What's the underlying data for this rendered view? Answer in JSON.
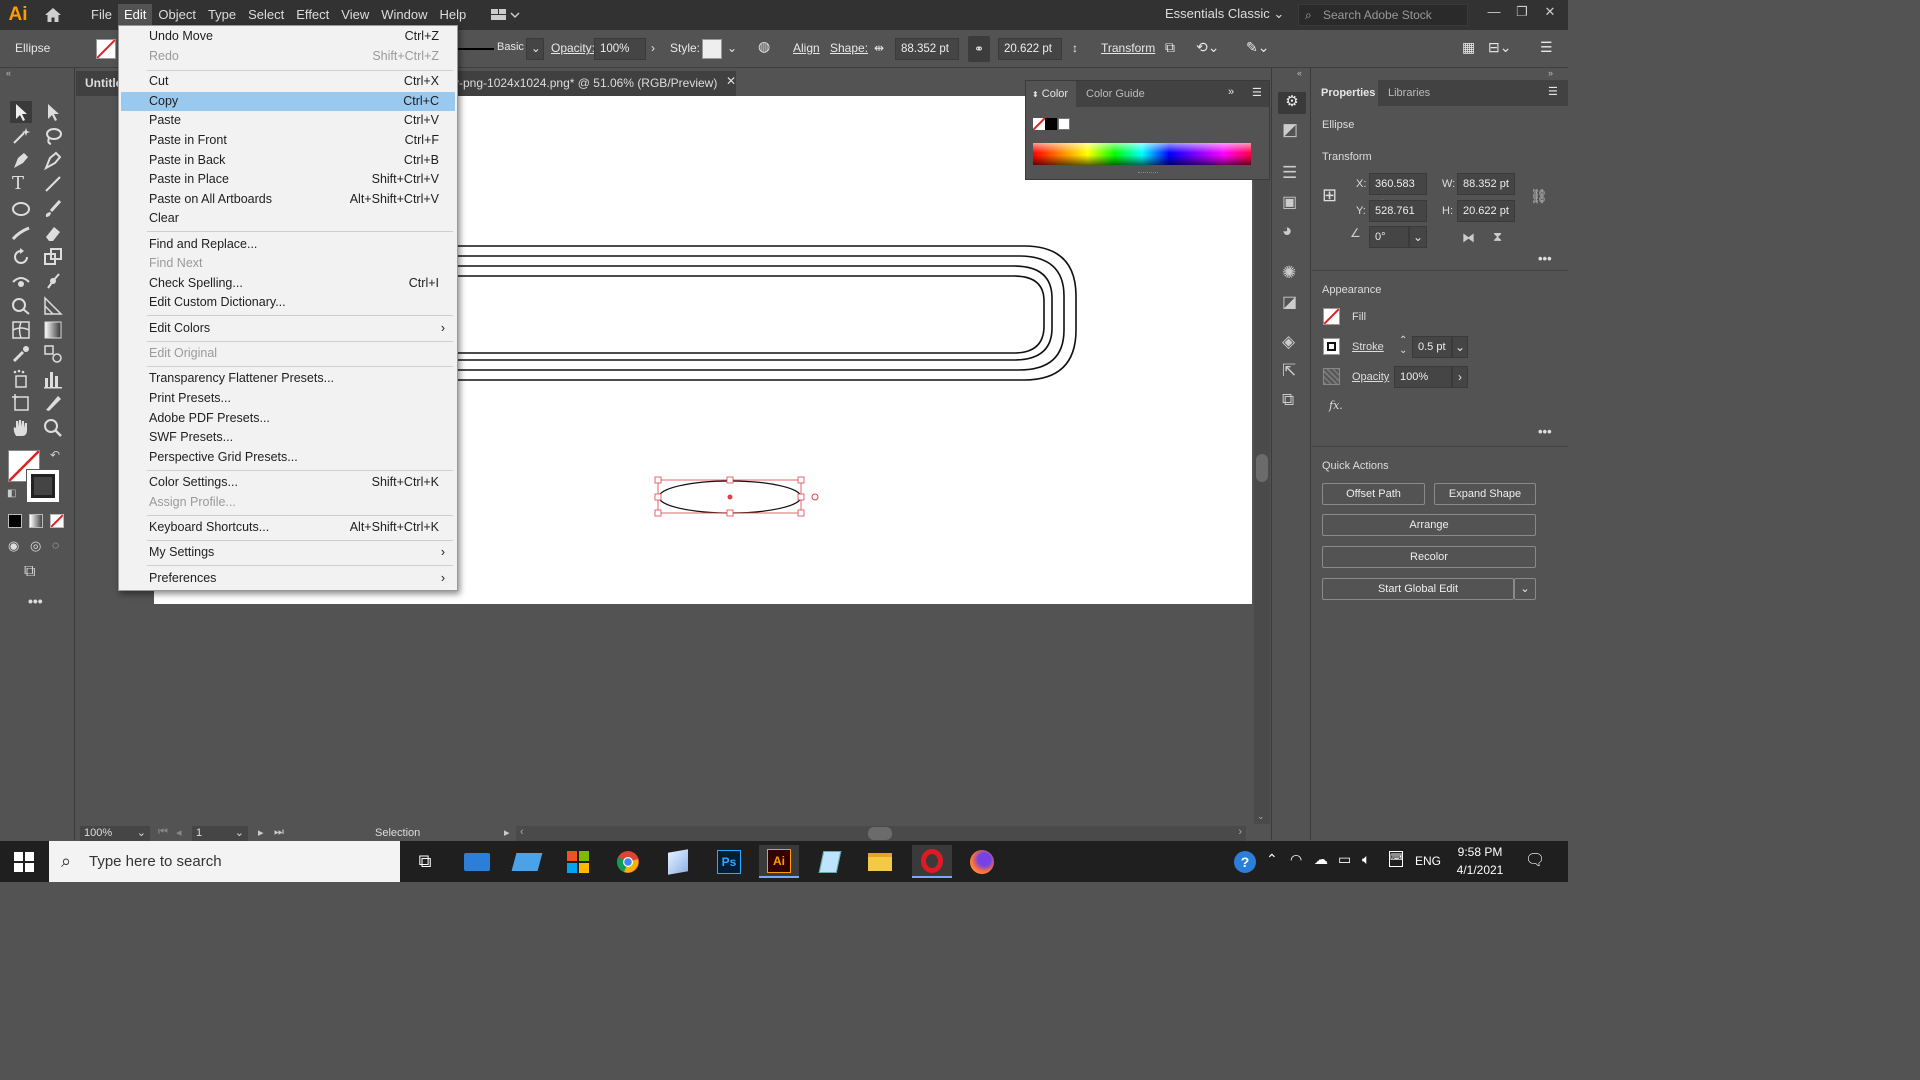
{
  "app": {
    "logo": "Ai",
    "workspace": "Essentials Classic",
    "stock_search_placeholder": "Search Adobe Stock"
  },
  "menubar": [
    "File",
    "Edit",
    "Object",
    "Type",
    "Select",
    "Effect",
    "View",
    "Window",
    "Help"
  ],
  "control_bar": {
    "selection_type": "Ellipse",
    "stroke_style": "Basic",
    "opacity_label": "Opacity:",
    "opacity_value": "100%",
    "style_label": "Style:",
    "align_label": "Align",
    "shape_label": "Shape:",
    "width_value": "88.352 pt",
    "height_value": "20.622 pt",
    "transform_label": "Transform"
  },
  "document": {
    "tab_title_left": "Untitle",
    "tab_title_right": "y-png-1024x1024.png* @ 51.06% (RGB/Preview)"
  },
  "color_panel": {
    "tab_color": "Color",
    "tab_color_guide": "Color Guide"
  },
  "properties": {
    "tab_properties": "Properties",
    "tab_libraries": "Libraries",
    "object_type": "Ellipse",
    "transform_title": "Transform",
    "x_label": "X:",
    "x_value": "360.583 pt",
    "y_label": "Y:",
    "y_value": "528.761 pt",
    "w_label": "W:",
    "w_value": "88.352 pt",
    "h_label": "H:",
    "h_value": "20.622 pt",
    "rotate_value": "0°",
    "appearance_title": "Appearance",
    "fill_label": "Fill",
    "stroke_label": "Stroke",
    "stroke_value": "0.5 pt",
    "opacity_label": "Opacity",
    "opacity_value": "100%",
    "fx_label": "fx.",
    "quick_actions_title": "Quick Actions",
    "btn_offset_path": "Offset Path",
    "btn_expand_shape": "Expand Shape",
    "btn_arrange": "Arrange",
    "btn_recolor": "Recolor",
    "btn_global_edit": "Start Global Edit"
  },
  "status_bar": {
    "zoom": "100%",
    "artboard_num": "1",
    "tool": "Selection"
  },
  "edit_menu": [
    {
      "label": "Undo Move",
      "shortcut": "Ctrl+Z"
    },
    {
      "label": "Redo",
      "shortcut": "Shift+Ctrl+Z",
      "disabled": true
    },
    {
      "label": "Cut",
      "shortcut": "Ctrl+X"
    },
    {
      "label": "Copy",
      "shortcut": "Ctrl+C",
      "highlighted": true
    },
    {
      "label": "Paste",
      "shortcut": "Ctrl+V"
    },
    {
      "label": "Paste in Front",
      "shortcut": "Ctrl+F"
    },
    {
      "label": "Paste in Back",
      "shortcut": "Ctrl+B"
    },
    {
      "label": "Paste in Place",
      "shortcut": "Shift+Ctrl+V"
    },
    {
      "label": "Paste on All Artboards",
      "shortcut": "Alt+Shift+Ctrl+V"
    },
    {
      "label": "Clear",
      "shortcut": ""
    },
    {
      "label": "Find and Replace...",
      "shortcut": ""
    },
    {
      "label": "Find Next",
      "shortcut": "",
      "disabled": true
    },
    {
      "label": "Check Spelling...",
      "shortcut": "Ctrl+I"
    },
    {
      "label": "Edit Custom Dictionary...",
      "shortcut": ""
    },
    {
      "label": "Edit Colors",
      "shortcut": "",
      "submenu": true
    },
    {
      "label": "Edit Original",
      "shortcut": "",
      "disabled": true
    },
    {
      "label": "Transparency Flattener Presets...",
      "shortcut": ""
    },
    {
      "label": "Print Presets...",
      "shortcut": ""
    },
    {
      "label": "Adobe PDF Presets...",
      "shortcut": ""
    },
    {
      "label": "SWF Presets...",
      "shortcut": ""
    },
    {
      "label": "Perspective Grid Presets...",
      "shortcut": ""
    },
    {
      "label": "Color Settings...",
      "shortcut": "Shift+Ctrl+K"
    },
    {
      "label": "Assign Profile...",
      "shortcut": "",
      "disabled": true
    },
    {
      "label": "Keyboard Shortcuts...",
      "shortcut": "Alt+Shift+Ctrl+K"
    },
    {
      "label": "My Settings",
      "shortcut": "",
      "submenu": true
    },
    {
      "label": "Preferences",
      "shortcut": "",
      "submenu": true
    }
  ],
  "taskbar": {
    "search_placeholder": "Type here to search",
    "language": "ENG",
    "time": "9:58 PM",
    "date": "4/1/2021"
  }
}
